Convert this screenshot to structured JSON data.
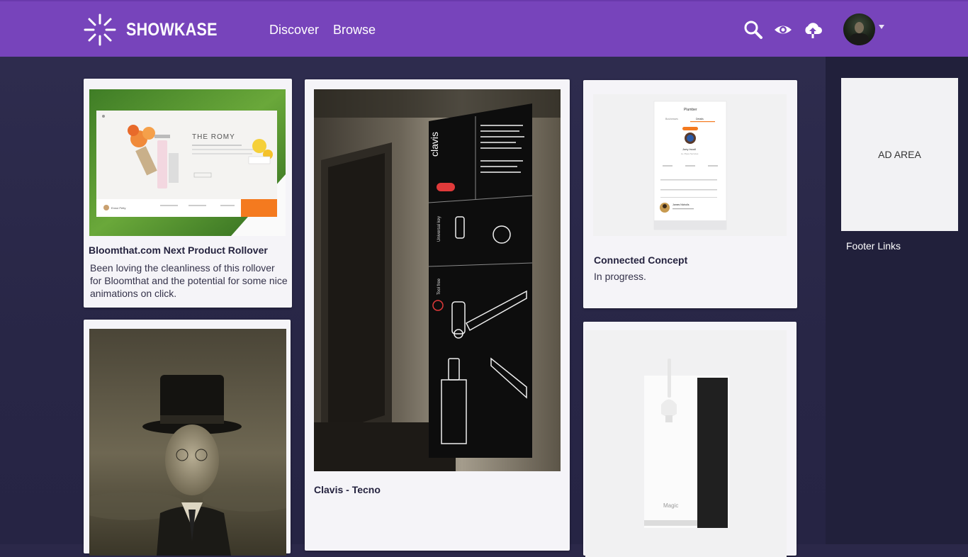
{
  "header": {
    "brand": "SHOWKASE",
    "nav": [
      {
        "label": "Discover"
      },
      {
        "label": "Browse"
      }
    ],
    "icons": [
      "search-icon",
      "eye-icon",
      "upload-cloud-icon"
    ],
    "accent_color": "#7744bb"
  },
  "cards": [
    {
      "title": "Bloomthat.com Next Product Rollover",
      "description": "Been loving the cleanliness of this rollover for Bloomthat and the potential for some nice animations on click."
    },
    {
      "title": "Clavis - Tecno",
      "description": ""
    },
    {
      "title": "Connected Concept",
      "description": "In progress."
    },
    {
      "title": "",
      "description": ""
    },
    {
      "title": "",
      "description": ""
    }
  ],
  "thumbs": {
    "romy_title": "THE ROMY",
    "romy_author": "Ennui Petty",
    "clavis_word": "clavis",
    "clavis_label_1": "Universal key",
    "clavis_label_2": "Tool free",
    "phone_title": "Plumber",
    "phone_tab_1": "Businesses",
    "phone_tab_2": "Details",
    "phone_name": "Joey Incoll",
    "phone_sub": "A+ Pipes Services",
    "phone_contact_name": "James Nicholls",
    "magic_label": "Magic"
  },
  "sidebar": {
    "ad_label": "AD AREA",
    "footer_links": "Footer Links"
  }
}
